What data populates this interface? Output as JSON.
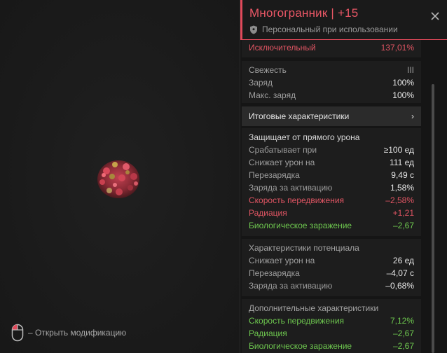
{
  "viewport": {
    "hint": "– Открыть модификацию",
    "icons": {
      "mouse": "mouse-right-click-icon",
      "artifact": "polyhedron-artifact-image"
    }
  },
  "panel": {
    "title": "Многогранник | +15",
    "subtitle": "Персональный при использовании",
    "icons": {
      "shield": "shield-icon",
      "close": "close-icon",
      "chevron": "chevron-right-icon"
    },
    "colors": {
      "accent": "#e0495a",
      "negative": "#e05563",
      "positive": "#6ec84f"
    }
  },
  "rarity": {
    "label": "Исключительный",
    "value": "137,01%"
  },
  "freshness": [
    {
      "label": "Свежесть",
      "value": "III"
    },
    {
      "label": "Заряд",
      "value": "100%"
    },
    {
      "label": "Макс. заряд",
      "value": "100%"
    }
  ],
  "total_stats": {
    "label": "Итоговые характеристики",
    "chevron": "›"
  },
  "protection": {
    "heading": "Защищает от прямого урона",
    "rows": [
      {
        "label": "Срабатывает при",
        "value": "≥100 ед",
        "tone": "normal"
      },
      {
        "label": "Снижает урон на",
        "value": "111 ед",
        "tone": "normal"
      },
      {
        "label": "Перезарядка",
        "value": "9,49 с",
        "tone": "normal"
      },
      {
        "label": "Заряда за активацию",
        "value": "1,58%",
        "tone": "normal"
      },
      {
        "label": "Скорость передвижения",
        "value": "–2,58%",
        "tone": "red"
      },
      {
        "label": "Радиация",
        "value": "+1,21",
        "tone": "red"
      },
      {
        "label": "Биологическое заражение",
        "value": "–2,67",
        "tone": "green"
      }
    ]
  },
  "potential": {
    "heading": "Характеристики потенциала",
    "rows": [
      {
        "label": "Снижает урон на",
        "value": "26 ед"
      },
      {
        "label": "Перезарядка",
        "value": "–4,07 с"
      },
      {
        "label": "Заряда за активацию",
        "value": "–0,68%"
      }
    ]
  },
  "extra": {
    "heading": "Дополнительные характеристики",
    "rows": [
      {
        "label": "Скорость передвижения",
        "value": "7,12%"
      },
      {
        "label": "Радиация",
        "value": "–2,67"
      },
      {
        "label": "Биологическое заражение",
        "value": "–2,67"
      }
    ]
  }
}
